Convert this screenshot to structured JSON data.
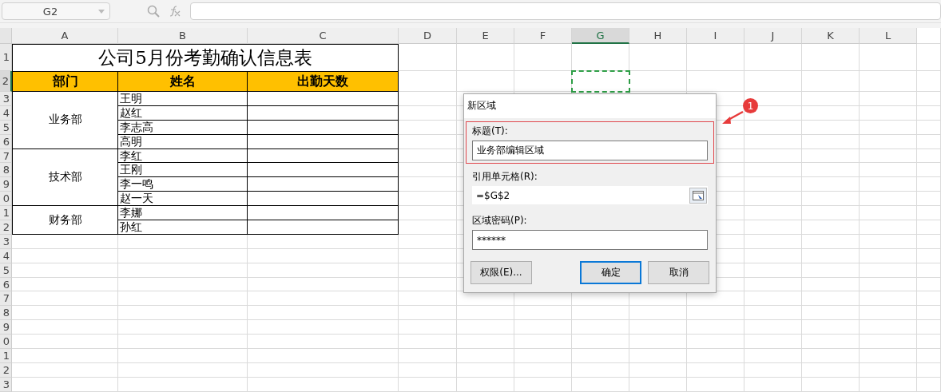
{
  "name_box": {
    "value": "G2"
  },
  "columns": [
    {
      "label": "A",
      "selected": false
    },
    {
      "label": "B",
      "selected": false
    },
    {
      "label": "C",
      "selected": false
    },
    {
      "label": "D",
      "selected": false
    },
    {
      "label": "E",
      "selected": false
    },
    {
      "label": "F",
      "selected": false
    },
    {
      "label": "G",
      "selected": true
    },
    {
      "label": "H",
      "selected": false
    },
    {
      "label": "I",
      "selected": false
    },
    {
      "label": "J",
      "selected": false
    },
    {
      "label": "K",
      "selected": false
    },
    {
      "label": "L",
      "selected": false
    }
  ],
  "rows": [
    {
      "label": "1",
      "selected": false
    },
    {
      "label": "2",
      "selected": true
    },
    {
      "label": "3",
      "selected": false
    },
    {
      "label": "4",
      "selected": false
    },
    {
      "label": "5",
      "selected": false
    },
    {
      "label": "6",
      "selected": false
    },
    {
      "label": "7",
      "selected": false
    },
    {
      "label": "8",
      "selected": false
    },
    {
      "label": "9",
      "selected": false
    },
    {
      "label": "0",
      "selected": false
    },
    {
      "label": "1",
      "selected": false
    },
    {
      "label": "2",
      "selected": false
    },
    {
      "label": "3",
      "selected": false
    },
    {
      "label": "4",
      "selected": false
    },
    {
      "label": "5",
      "selected": false
    },
    {
      "label": "6",
      "selected": false
    },
    {
      "label": "7",
      "selected": false
    },
    {
      "label": "8",
      "selected": false
    },
    {
      "label": "9",
      "selected": false
    },
    {
      "label": "0",
      "selected": false
    },
    {
      "label": "1",
      "selected": false
    },
    {
      "label": "2",
      "selected": false
    },
    {
      "label": "3",
      "selected": false
    }
  ],
  "table": {
    "title": "公司5月份考勤确认信息表",
    "headers": [
      "部门",
      "姓名",
      "出勤天数"
    ],
    "groups": [
      {
        "department": "业务部",
        "names": [
          "王明",
          "赵红",
          "李志高",
          "高明"
        ]
      },
      {
        "department": "技术部",
        "names": [
          "李红",
          "王刚",
          "李一鸣",
          "赵一天"
        ]
      },
      {
        "department": "财务部",
        "names": [
          "李娜",
          "孙红"
        ]
      }
    ]
  },
  "dialog": {
    "title": "新区域",
    "fields": [
      {
        "kind": "text",
        "label": "标题(T):",
        "value": "业务部编辑区域",
        "highlighted": true
      },
      {
        "kind": "ref",
        "label": "引用单元格(R):",
        "value": "=$G$2",
        "highlighted": false
      },
      {
        "kind": "text",
        "label": "区域密码(P):",
        "value": "******",
        "highlighted": false
      }
    ],
    "buttons": [
      {
        "label": "权限(E)...",
        "default": false
      },
      {
        "label": "确定",
        "default": true
      },
      {
        "label": "取消",
        "default": false
      }
    ]
  },
  "annotation": {
    "label": "1"
  }
}
